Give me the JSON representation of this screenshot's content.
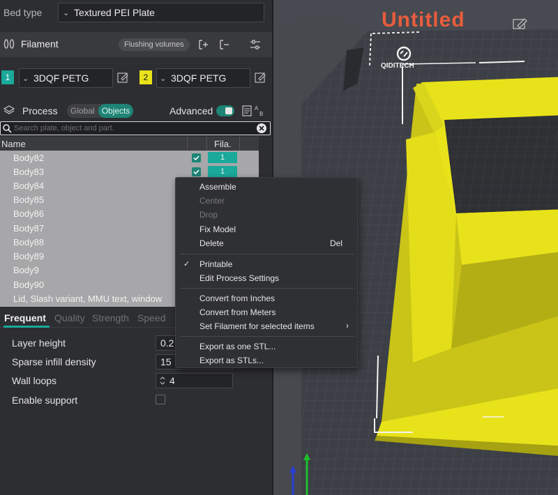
{
  "bed": {
    "label": "Bed type",
    "value": "Textured PEI Plate"
  },
  "filament": {
    "title": "Filament",
    "flushing_label": "Flushing volumes",
    "slots": [
      {
        "index": "1",
        "name": "3DQF PETG",
        "color": "#1aa99a"
      },
      {
        "index": "2",
        "name": "3DQF PETG",
        "color": "#e8e21a"
      }
    ]
  },
  "process": {
    "title": "Process",
    "segment": {
      "global": "Global",
      "objects": "Objects"
    },
    "advanced_label": "Advanced",
    "advanced_on": true
  },
  "search": {
    "placeholder": "Search plate, object and part."
  },
  "object_list": {
    "columns": {
      "name": "Name",
      "fila": "Fila."
    },
    "rows": [
      {
        "name": "Body82",
        "checked": true,
        "fila": "1"
      },
      {
        "name": "Body83",
        "checked": true,
        "fila": "1"
      },
      {
        "name": "Body84"
      },
      {
        "name": "Body85"
      },
      {
        "name": "Body86"
      },
      {
        "name": "Body87"
      },
      {
        "name": "Body88"
      },
      {
        "name": "Body89"
      },
      {
        "name": "Body9"
      },
      {
        "name": "Body90"
      },
      {
        "name": "Lid, Slash variant, MMU text, window"
      }
    ]
  },
  "settings_tabs": [
    "Frequent",
    "Quality",
    "Strength",
    "Speed"
  ],
  "settings": {
    "layer_height": {
      "label": "Layer height",
      "value": "0.2"
    },
    "sparse_infill": {
      "label": "Sparse infill density",
      "value": "15"
    },
    "wall_loops": {
      "label": "Wall loops",
      "value": "4"
    },
    "enable_support": {
      "label": "Enable support",
      "checked": false
    }
  },
  "viewport": {
    "title": "Untitled",
    "logo_text": "QIDITECH"
  },
  "context_menu": {
    "items": [
      {
        "label": "Assemble",
        "enabled": true
      },
      {
        "label": "Center",
        "enabled": false
      },
      {
        "label": "Drop",
        "enabled": false
      },
      {
        "label": "Fix Model",
        "enabled": true
      },
      {
        "label": "Delete",
        "enabled": true,
        "shortcut": "Del"
      },
      {
        "label": "Printable",
        "enabled": true,
        "checked": true
      },
      {
        "label": "Edit Process Settings",
        "enabled": true
      },
      {
        "label": "Convert from Inches",
        "enabled": true
      },
      {
        "label": "Convert from Meters",
        "enabled": true
      },
      {
        "label": "Set Filament for selected items",
        "enabled": true,
        "submenu": true
      },
      {
        "label": "Export as one STL...",
        "enabled": true
      },
      {
        "label": "Export as STLs...",
        "enabled": true
      }
    ]
  },
  "colors": {
    "accent": "#1e8475",
    "model_yellow": "#e8e21a",
    "title_orange": "#e75d3d"
  }
}
